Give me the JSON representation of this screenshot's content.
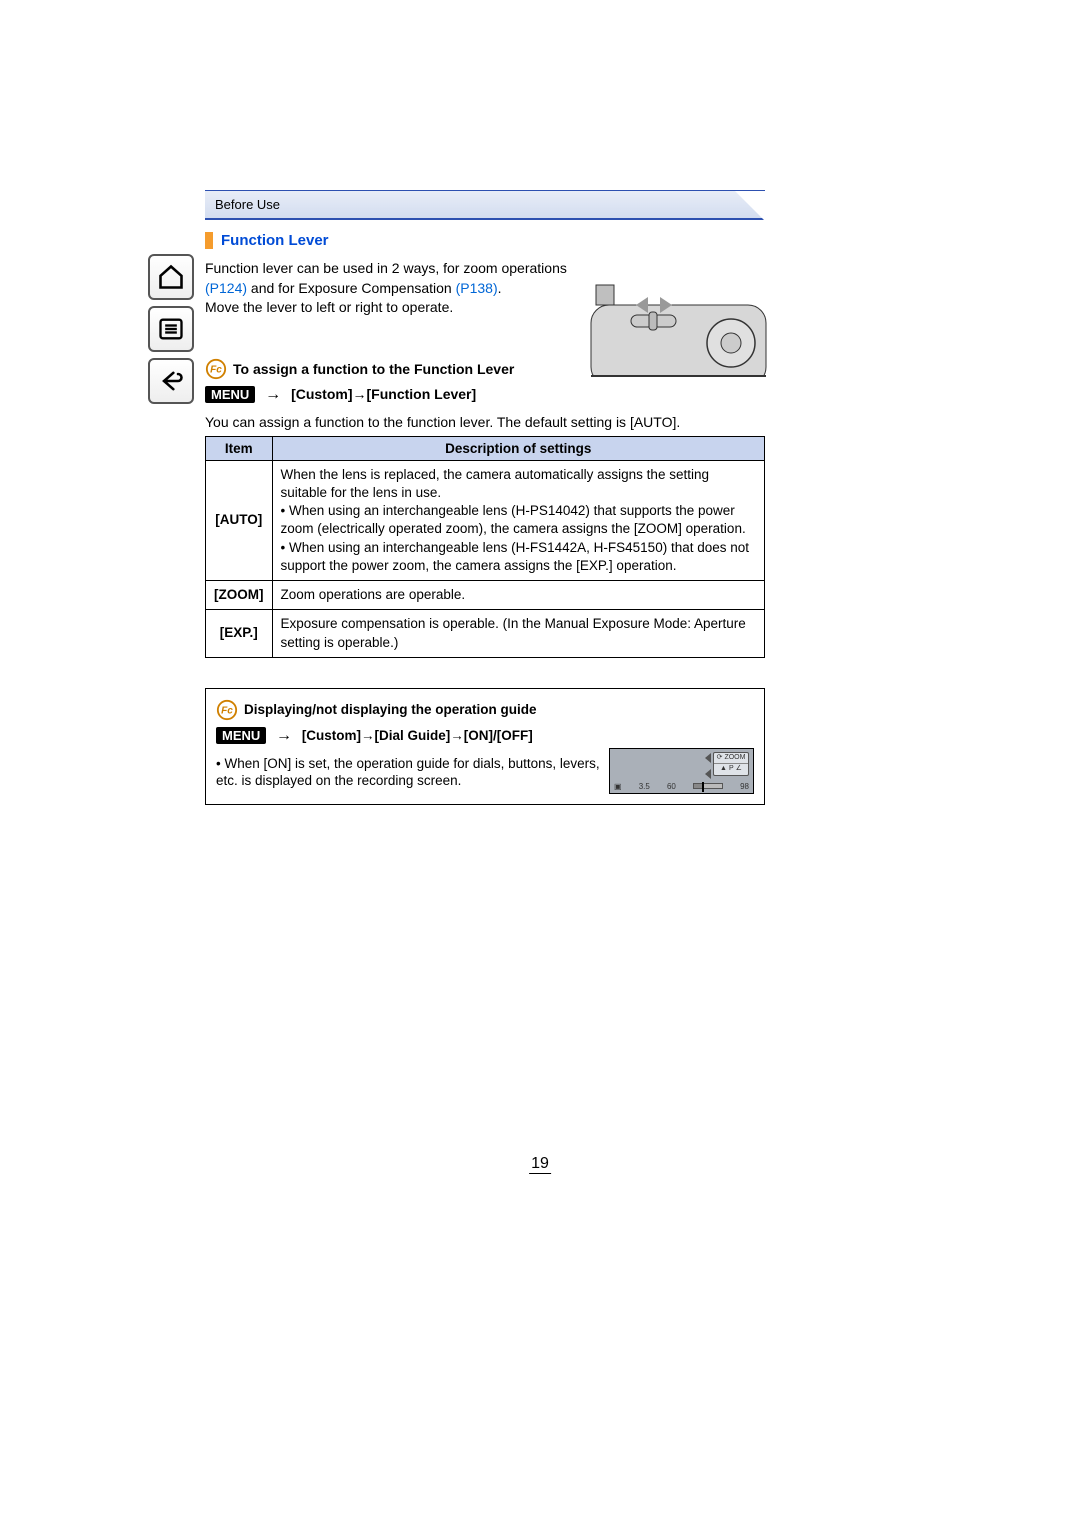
{
  "breadcrumb": "Before Use",
  "section_title": "Function Lever",
  "intro": {
    "line1": "Function lever can be used in 2 ways, for zoom operations ",
    "ref1": "(P124)",
    "mid": " and for Exposure Compensation ",
    "ref2": "(P138)",
    "end": ".",
    "line2": "Move the lever to left or right to operate."
  },
  "assign": {
    "title": "To assign a function to the Function Lever",
    "menu_label": "MENU",
    "path": "[Custom]→[Function Lever]",
    "desc": "You can assign a function to the function lever. The default setting is [AUTO]."
  },
  "table": {
    "headers": {
      "item": "Item",
      "desc": "Description of settings"
    },
    "rows": [
      {
        "item": "[AUTO]",
        "desc_main": "When the lens is replaced, the camera automatically assigns the setting suitable for the lens in use.",
        "bullet1": "When using an interchangeable lens (H-PS14042) that supports the power zoom (electrically operated zoom), the camera assigns the [ZOOM] operation.",
        "bullet2": "When using an interchangeable lens (H-FS1442A, H-FS45150) that does not support the power zoom, the camera assigns the [EXP.] operation."
      },
      {
        "item": "[ZOOM]",
        "desc_main": "Zoom operations are operable."
      },
      {
        "item": "[EXP.]",
        "desc_main": "Exposure compensation is operable. (In the Manual Exposure Mode: Aperture setting is operable.)"
      }
    ]
  },
  "guide": {
    "title": "Displaying/not displaying the operation guide",
    "menu_label": "MENU",
    "path": "[Custom]→[Dial Guide]→[ON]/[OFF]",
    "note": "When [ON] is set, the operation guide for dials, buttons, levers, etc. is displayed on the recording screen.",
    "screen": {
      "zoom_label": "ZOOM",
      "pz_label": "P",
      "left1": "3.5",
      "left2": "60",
      "right": "98"
    }
  },
  "page_number": "19"
}
